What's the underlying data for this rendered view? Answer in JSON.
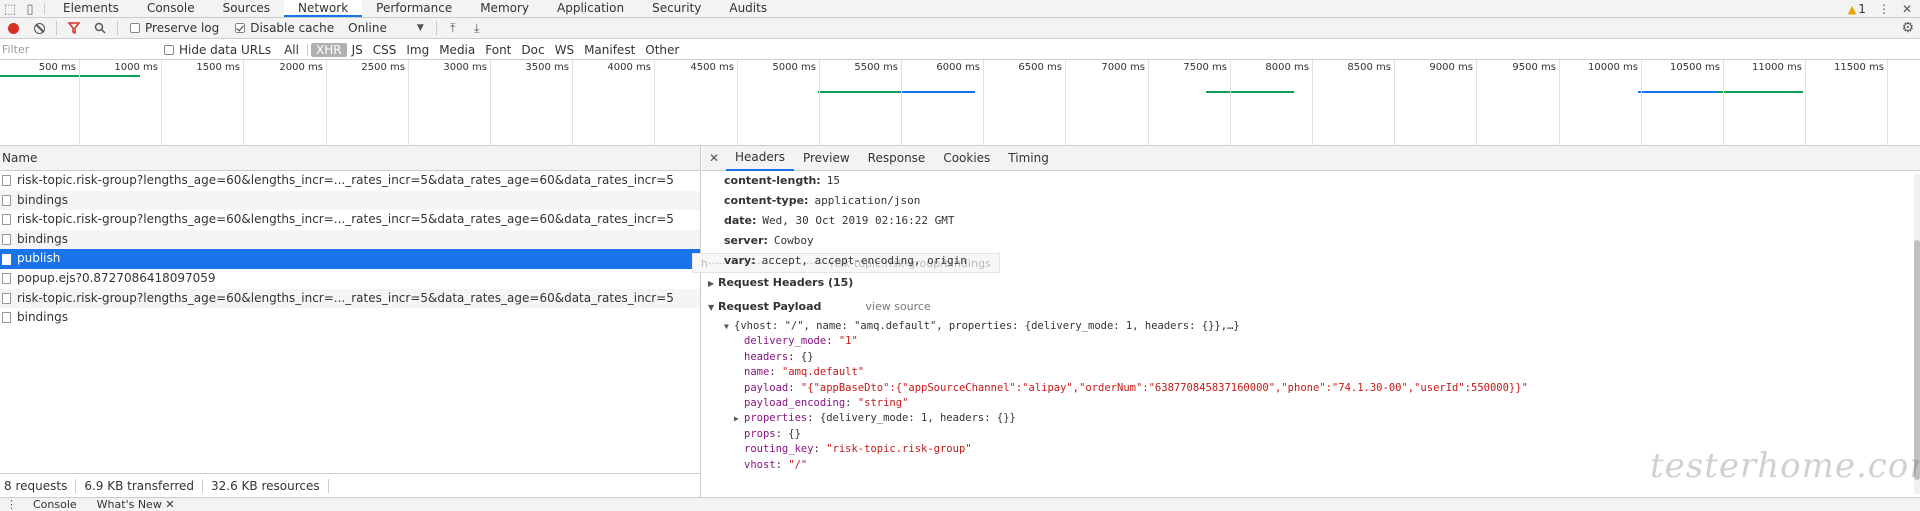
{
  "tabs": [
    "Elements",
    "Console",
    "Sources",
    "Network",
    "Performance",
    "Memory",
    "Application",
    "Security",
    "Audits"
  ],
  "active_tab": "Network",
  "warning_count": "1",
  "toolbar": {
    "preserve_log": "Preserve log",
    "disable_cache": "Disable cache",
    "throttle": "Online"
  },
  "filter": {
    "placeholder": "Filter",
    "hide_data_urls": "Hide data URLs",
    "types": [
      "All",
      "XHR",
      "JS",
      "CSS",
      "Img",
      "Media",
      "Font",
      "Doc",
      "WS",
      "Manifest",
      "Other"
    ],
    "active_type": "XHR"
  },
  "timeline": {
    "ticks": [
      "500 ms",
      "1000 ms",
      "1500 ms",
      "2000 ms",
      "2500 ms",
      "3000 ms",
      "3500 ms",
      "4000 ms",
      "4500 ms",
      "5000 ms",
      "5500 ms",
      "6000 ms",
      "6500 ms",
      "7000 ms",
      "7500 ms",
      "8000 ms",
      "8500 ms",
      "9000 ms",
      "9500 ms",
      "10000 ms",
      "10500 ms",
      "11000 ms",
      "11500 ms"
    ]
  },
  "requests": {
    "header": "Name",
    "rows": [
      "risk-topic.risk-group?lengths_age=60&lengths_incr=..._rates_incr=5&data_rates_age=60&data_rates_incr=5",
      "bindings",
      "risk-topic.risk-group?lengths_age=60&lengths_incr=..._rates_incr=5&data_rates_age=60&data_rates_incr=5",
      "bindings",
      "publish",
      "popup.ejs?0.8727086418097059",
      "risk-topic.risk-group?lengths_age=60&lengths_incr=..._rates_incr=5&data_rates_age=60&data_rates_incr=5",
      "bindings"
    ],
    "selected_index": 4
  },
  "status": {
    "requests": "8 requests",
    "transferred": "6.9 KB transferred",
    "resources": "32.6 KB resources"
  },
  "details": {
    "tabs": [
      "Headers",
      "Preview",
      "Response",
      "Cookies",
      "Timing"
    ],
    "active_tab": "Headers",
    "response_headers": [
      {
        "key": "content-length:",
        "value": "15"
      },
      {
        "key": "content-type:",
        "value": "application/json"
      },
      {
        "key": "date:",
        "value": "Wed, 30 Oct 2019 02:16:22 GMT"
      },
      {
        "key": "server:",
        "value": "Cowboy"
      },
      {
        "key": "vary:",
        "value": "accept, accept-encoding, origin"
      }
    ],
    "tooltip": "h···································risk-topic.risk-group/bindings",
    "request_headers_title": "Request Headers (15)",
    "payload_title": "Request Payload",
    "view_source": "view source",
    "payload": {
      "summary": "{vhost: \"/\", name: \"amq.default\", properties: {delivery_mode: 1, headers: {}},…}",
      "delivery_mode": "\"1\"",
      "headers": "{}",
      "name": "\"amq.default\"",
      "payload": "\"{\"appBaseDto\":{\"appSourceChannel\":\"alipay\",\"orderNum\":\"638770845837160000\",\"phone\":\"74.1.30-00\",\"userId\":550000}}\"",
      "payload_encoding": "\"string\"",
      "properties": "{delivery_mode: 1, headers: {}}",
      "props": "{}",
      "routing_key": "\"risk-topic.risk-group\"",
      "vhost": "\"/\""
    }
  },
  "drawer": [
    "Console",
    "What's New"
  ],
  "watermark": "testerhome.com",
  "colors": {
    "accent": "#1a73e8",
    "record": "#d93025",
    "timeline_green": "#0f9d58",
    "timeline_blue": "#1a73e8"
  }
}
